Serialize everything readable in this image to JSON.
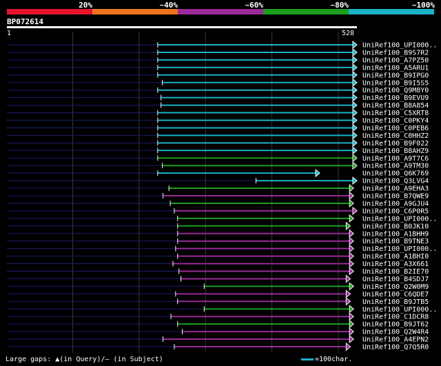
{
  "query": {
    "id": "BP072614",
    "start": "1",
    "end": "528"
  },
  "legend": {
    "labels": [
      "20%",
      "~40%",
      "~60%",
      "~80%",
      "~100%"
    ],
    "colors": [
      "#e8142d",
      "#ee7420",
      "#9a2a9a",
      "#1e9e1e",
      "#1ab4c8"
    ]
  },
  "footer": {
    "gaps": "Large gaps: ▲(in Query)/– (in Subject)",
    "scale": "=100char."
  },
  "chart_data": {
    "type": "alignment",
    "query_length": 528,
    "hits": [
      {
        "name": "UniRef100_UPI000..",
        "start": 228,
        "end": 528,
        "identity": "~100%"
      },
      {
        "name": "UniRef100_B9S7R2",
        "start": 228,
        "end": 528,
        "identity": "~100%"
      },
      {
        "name": "UniRef100_A7PZ50",
        "start": 228,
        "end": 528,
        "identity": "~100%"
      },
      {
        "name": "UniRef100_A5ARU1",
        "start": 228,
        "end": 528,
        "identity": "~100%"
      },
      {
        "name": "UniRef100_B9IPG0",
        "start": 228,
        "end": 528,
        "identity": "~100%"
      },
      {
        "name": "UniRef100_B9I5S5",
        "start": 235,
        "end": 528,
        "identity": "~100%"
      },
      {
        "name": "UniRef100_Q9M8Y0",
        "start": 228,
        "end": 528,
        "identity": "~100%"
      },
      {
        "name": "UniRef100_B9EVU9",
        "start": 233,
        "end": 528,
        "identity": "~100%"
      },
      {
        "name": "UniRef100_B8A854",
        "start": 233,
        "end": 528,
        "identity": "~100%"
      },
      {
        "name": "UniRef100_C5XRT8",
        "start": 228,
        "end": 528,
        "identity": "~100%"
      },
      {
        "name": "UniRef100_C0PKY4",
        "start": 228,
        "end": 528,
        "identity": "~100%"
      },
      {
        "name": "UniRef100_C0PEB6",
        "start": 228,
        "end": 528,
        "identity": "~100%"
      },
      {
        "name": "UniRef100_C0HHZ2",
        "start": 228,
        "end": 528,
        "identity": "~100%"
      },
      {
        "name": "UniRef100_B9F022",
        "start": 228,
        "end": 528,
        "identity": "~100%"
      },
      {
        "name": "UniRef100_B8AHZ9",
        "start": 228,
        "end": 528,
        "identity": "~100%"
      },
      {
        "name": "UniRef100_A9T7C6",
        "start": 228,
        "end": 528,
        "identity": "~80%"
      },
      {
        "name": "UniRef100_A9TM30",
        "start": 235,
        "end": 528,
        "identity": "~80%"
      },
      {
        "name": "UniRef100_Q6K769",
        "start": 228,
        "end": 472,
        "identity": "~100%"
      },
      {
        "name": "UniRef100_Q3LVG4",
        "start": 376,
        "end": 528,
        "identity": "~100%"
      },
      {
        "name": "UniRef100_A9EHA3",
        "start": 245,
        "end": 523,
        "identity": "~80%"
      },
      {
        "name": "UniRef100_B7QWE9",
        "start": 236,
        "end": 523,
        "identity": "~60%"
      },
      {
        "name": "UniRef100_A9GJU4",
        "start": 247,
        "end": 523,
        "identity": "~80%"
      },
      {
        "name": "UniRef100_C6P0R5",
        "start": 253,
        "end": 528,
        "identity": "~60%"
      },
      {
        "name": "UniRef100_UPI000..",
        "start": 258,
        "end": 523,
        "identity": "~80%"
      },
      {
        "name": "UniRef100_B0JK10",
        "start": 258,
        "end": 518,
        "identity": "~80%"
      },
      {
        "name": "UniRef100_A1BHH9",
        "start": 258,
        "end": 523,
        "identity": "~60%"
      },
      {
        "name": "UniRef100_B9TNE3",
        "start": 258,
        "end": 523,
        "identity": "~60%"
      },
      {
        "name": "UniRef100_UPI000..",
        "start": 255,
        "end": 523,
        "identity": "~60%"
      },
      {
        "name": "UniRef100_A1BHI0",
        "start": 258,
        "end": 523,
        "identity": "~60%"
      },
      {
        "name": "UniRef100_A3X661",
        "start": 251,
        "end": 523,
        "identity": "~60%"
      },
      {
        "name": "UniRef100_B2IE70",
        "start": 260,
        "end": 523,
        "identity": "~60%"
      },
      {
        "name": "UniRef100_B4SDJ7",
        "start": 263,
        "end": 518,
        "identity": "~60%"
      },
      {
        "name": "UniRef100_Q2W0M9",
        "start": 298,
        "end": 523,
        "identity": "~80%"
      },
      {
        "name": "UniRef100_C6QDE7",
        "start": 255,
        "end": 518,
        "identity": "~60%"
      },
      {
        "name": "UniRef100_B9JTB5",
        "start": 258,
        "end": 518,
        "identity": "~60%"
      },
      {
        "name": "UniRef100_UPI000..",
        "start": 298,
        "end": 523,
        "identity": "~80%"
      },
      {
        "name": "UniRef100_C1DCR8",
        "start": 248,
        "end": 523,
        "identity": "~60%"
      },
      {
        "name": "UniRef100_B9JT62",
        "start": 258,
        "end": 523,
        "identity": "~80%"
      },
      {
        "name": "UniRef100_Q2W4R4",
        "start": 265,
        "end": 523,
        "identity": "~60%"
      },
      {
        "name": "UniRef100_A4EPN2",
        "start": 236,
        "end": 523,
        "identity": "~60%"
      },
      {
        "name": "UniRef100_Q7Q5R0",
        "start": 253,
        "end": 518,
        "identity": "~60%"
      }
    ]
  }
}
